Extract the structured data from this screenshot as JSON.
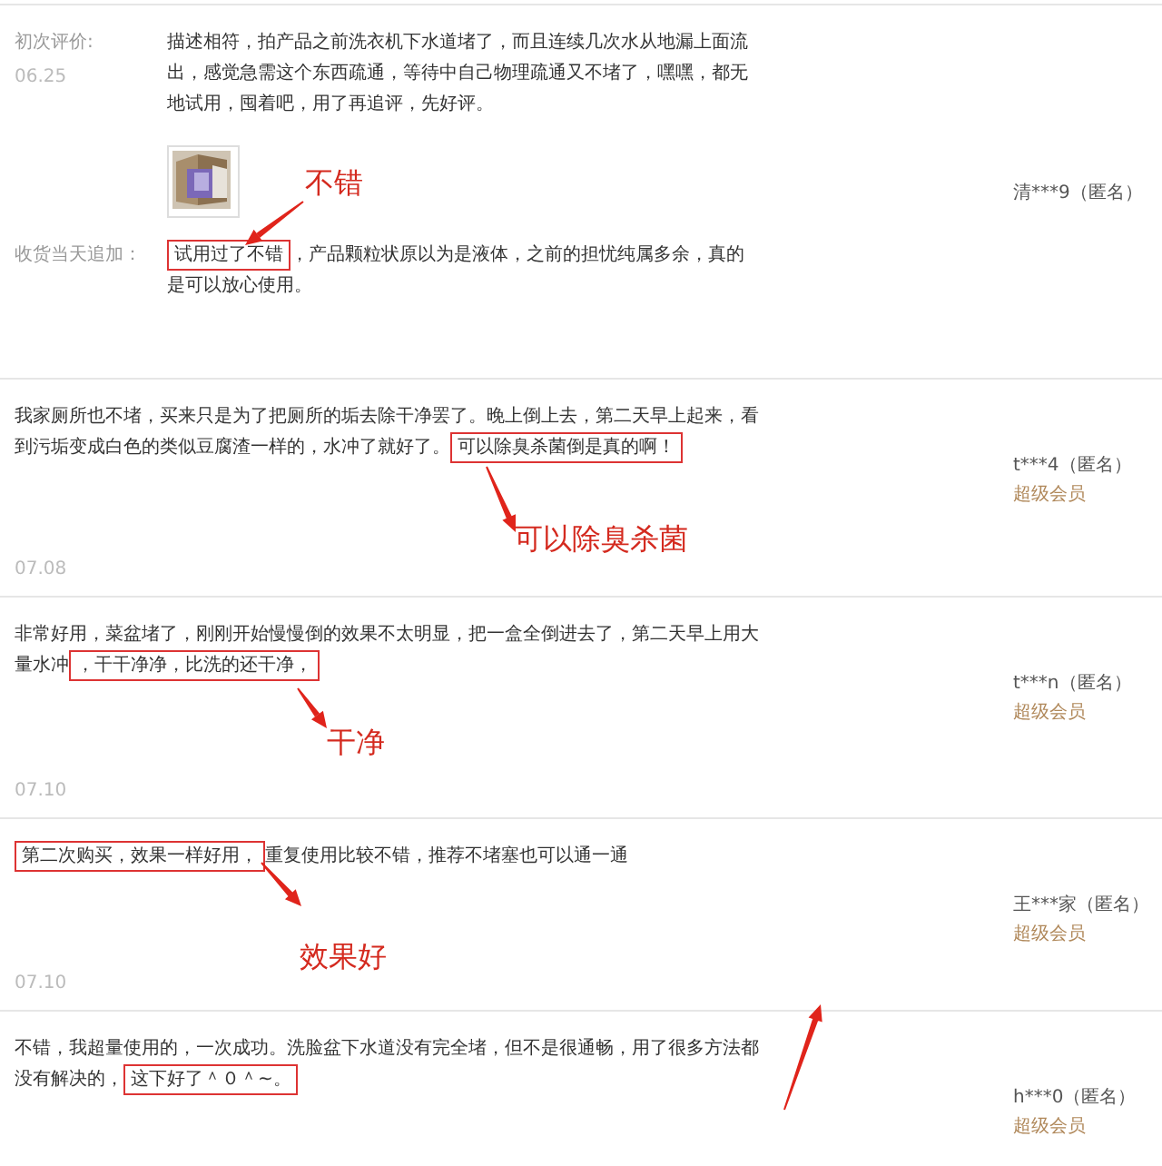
{
  "reviews": [
    {
      "kind": "followup",
      "initial_label": "初次评价:",
      "date": "06.25",
      "text": "描述相符，拍产品之前洗衣机下水道堵了，而且连续几次水从地漏上面流出，感觉急需这个东西疏通，等待中自己物理疏通又不堵了，嘿嘿，都无地试用，囤着吧，用了再追评，先好评。",
      "append_label": "收货当天追加：",
      "highlight": "试用过了不错",
      "after": "，产品颗粒状原以为是液体，之前的担忧纯属多余，真的是可以放心使用。",
      "user": "清***9（匿名）",
      "annotation": {
        "label": "不错",
        "kind": "down-left"
      }
    },
    {
      "kind": "plain",
      "date": "07.08",
      "before": "我家厕所也不堵，买来只是为了把厕所的垢去除干净罢了。晚上倒上去，第二天早上起来，看到污垢变成白色的类似豆腐渣一样的，水冲了就好了。",
      "highlight": "可以除臭杀菌倒是真的啊！",
      "user": "t***4（匿名）",
      "member": "超级会员",
      "annotation": {
        "label": "可以除臭杀菌",
        "kind": "down-right"
      }
    },
    {
      "kind": "plain",
      "date": "07.10",
      "before": "非常好用，菜盆堵了，刚刚开始慢慢倒的效果不太明显，把一盒全倒进去了，第二天早上用大量水冲",
      "highlight": "，干干净净，比洗的还干净，",
      "user": "t***n（匿名）",
      "member": "超级会员",
      "annotation": {
        "label": "干净",
        "kind": "down-right"
      }
    },
    {
      "kind": "plain",
      "date": "07.10",
      "highlight": "第二次购买，效果一样好用，",
      "after": "重复使用比较不错，推荐不堵塞也可以通一通",
      "user": "王***家（匿名）",
      "member": "超级会员",
      "annotation": {
        "label": "效果好",
        "kind": "down-right"
      }
    },
    {
      "kind": "plain",
      "before": "不错，我超量使用的，一次成功。洗脸盆下水道没有完全堵，但不是很通畅，用了很多方法都没有解决的，",
      "highlight": "这下好了＾０＾~。",
      "user": "h***0（匿名）",
      "member": "超级会员",
      "annotation": {
        "kind": "up-right"
      }
    }
  ]
}
